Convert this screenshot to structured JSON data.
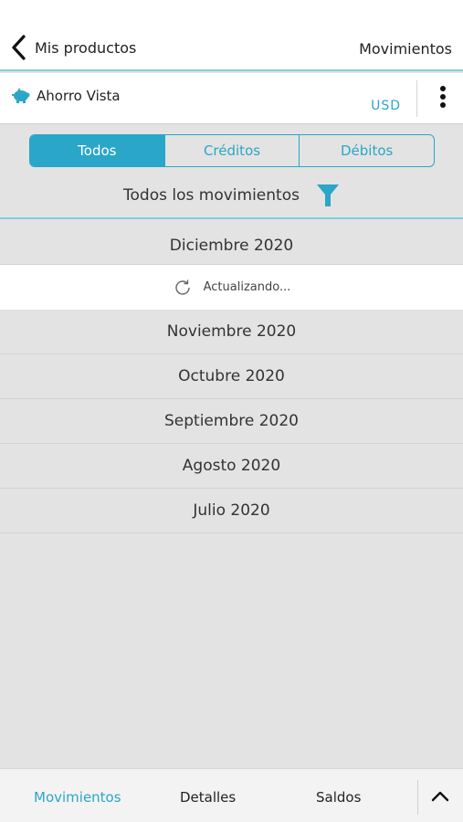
{
  "header": {
    "back_label": "Mis productos",
    "title": "Movimientos"
  },
  "account": {
    "name": "Ahorro Vista",
    "currency": "USD"
  },
  "filter_tabs": [
    {
      "label": "Todos",
      "active": true
    },
    {
      "label": "Créditos",
      "active": false
    },
    {
      "label": "Débitos",
      "active": false
    }
  ],
  "filter": {
    "label": "Todos los movimientos"
  },
  "months": {
    "current": "Diciembre 2020",
    "loading_text": "Actualizando...",
    "items": [
      "Noviembre 2020",
      "Octubre 2020",
      "Septiembre 2020",
      "Agosto 2020",
      "Julio 2020"
    ]
  },
  "bottom_tabs": [
    {
      "label": "Movimientos",
      "active": true
    },
    {
      "label": "Detalles",
      "active": false
    },
    {
      "label": "Saldos",
      "active": false
    }
  ],
  "colors": {
    "accent": "#2aa6c8",
    "background": "#e3e3e3"
  },
  "icons": {
    "back": "chevron-left-icon",
    "account": "piggy-bank-icon",
    "more": "more-vertical-icon",
    "filter": "filter-icon",
    "loading": "refresh-spinner-icon",
    "expand": "chevron-up-icon"
  }
}
